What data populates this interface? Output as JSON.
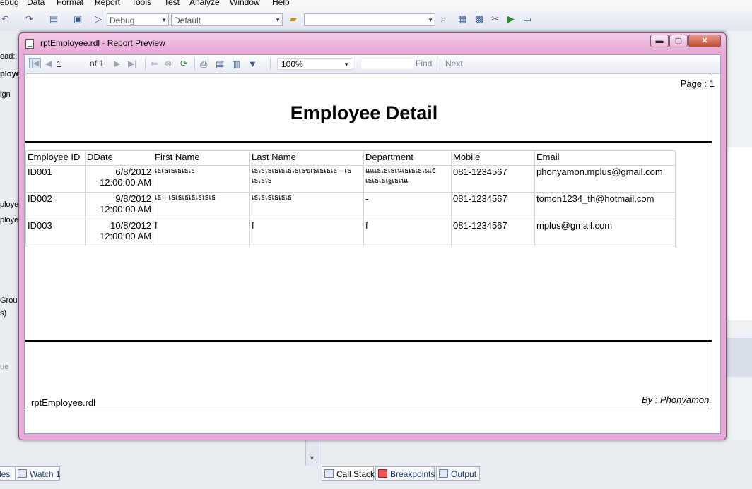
{
  "ide": {
    "menu": [
      "ebug",
      "Data",
      "Format",
      "Report",
      "Tools",
      "Test",
      "Analyze",
      "Window",
      "Help"
    ],
    "config": "Debug",
    "platform": "Default",
    "left_labels": [
      "ead:",
      "ploye",
      "ign",
      "ploye",
      "ploye",
      "Grou",
      "s)",
      "ue"
    ],
    "bottom_tabs": [
      "les",
      "Watch 1",
      "Call Stack",
      "Breakpoints",
      "Output"
    ]
  },
  "window": {
    "title": "rptEmployee.rdl - Report Preview",
    "min_label": "▬",
    "max_label": "▢",
    "close_label": "✕"
  },
  "report_toolbar": {
    "page_current": "1",
    "page_of": "of 1",
    "zoom": "100%",
    "find_label": "Find",
    "next_label": "Next"
  },
  "report": {
    "page_label": "Page : 1",
    "title": "Employee Detail",
    "columns": [
      "Employee ID",
      "DDate",
      "First Name",
      "Last Name",
      "Department",
      "Mobile",
      "Email"
    ],
    "rows": [
      {
        "id": "ID001",
        "date": "6/8/2012",
        "time": "12:00:00 AM",
        "first": "เธเธเธเธเธเธ",
        "last": "เธเธเธเธเธเธเธเธฃเธเธเธเธ—เธ เธเธเธ",
        "dept": "แแเธเธเธเนเธเธเธเนเ€ เธเธเธเฐเธเนเ",
        "mobile": "081-1234567",
        "email": "phonyamon.mplus@gmail.com"
      },
      {
        "id": "ID002",
        "date": "9/8/2012",
        "time": "12:00:00 AM",
        "first": "เธ—เธเธเธเธเธเธเธ",
        "last": "เธเธเธเธเธเธ",
        "dept": "-",
        "mobile": "081-1234567",
        "email": "tomon1234_th@hotmail.com"
      },
      {
        "id": "ID003",
        "date": "10/8/2012",
        "time": "12:00:00 AM",
        "first": "f",
        "last": "f",
        "dept": "f",
        "mobile": "081-1234567",
        "email": "mplus@gmail.com"
      }
    ],
    "footer_file": "rptEmployee.rdl",
    "footer_by": "By : Phonyamon."
  },
  "colors": {
    "window_frame": "#e7a9d7",
    "title_gradient_top": "#f4c9e8",
    "close_button": "#c44a33"
  }
}
